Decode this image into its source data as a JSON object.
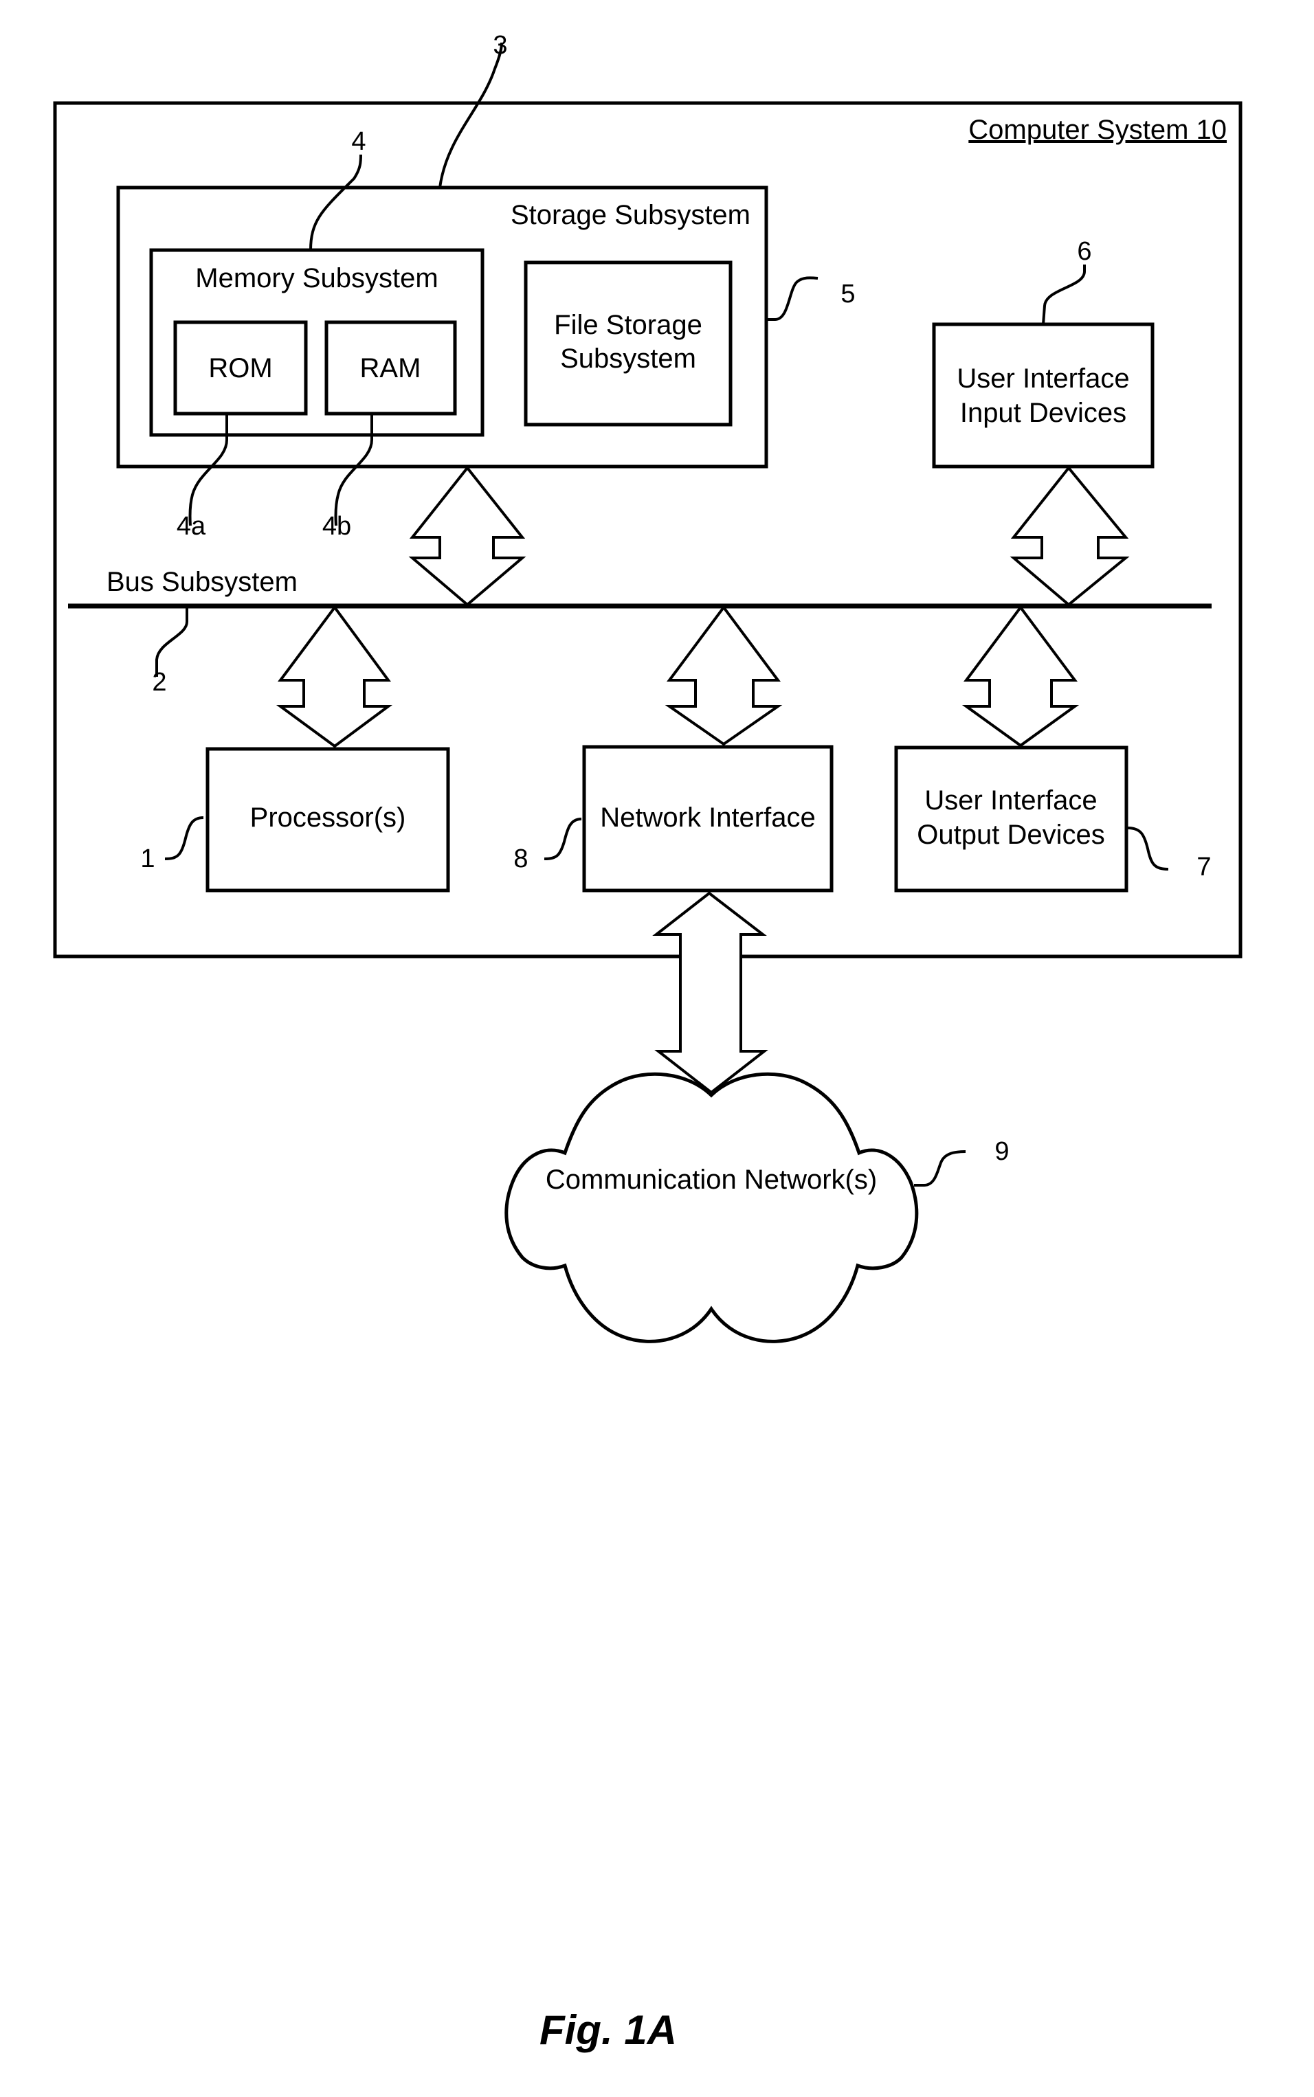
{
  "figure": {
    "caption": "Fig. 1A",
    "title": "Computer System 10"
  },
  "components": {
    "storage_subsystem": {
      "label": "Storage Subsystem",
      "ref": "3"
    },
    "memory_subsystem": {
      "label": "Memory Subsystem",
      "ref": "4"
    },
    "rom": {
      "label": "ROM",
      "ref": "4a"
    },
    "ram": {
      "label": "RAM",
      "ref": "4b"
    },
    "file_storage": {
      "line1": "File Storage",
      "line2": "Subsystem",
      "ref": "5"
    },
    "ui_input": {
      "line1": "User Interface",
      "line2": "Input Devices",
      "ref": "6"
    },
    "bus": {
      "label": "Bus Subsystem",
      "ref": "2"
    },
    "processor": {
      "label": "Processor(s)",
      "ref": "1"
    },
    "network_interface": {
      "label": "Network Interface",
      "ref": "8"
    },
    "ui_output": {
      "line1": "User Interface",
      "line2": "Output Devices",
      "ref": "7"
    },
    "network": {
      "label": "Communication Network(s)",
      "ref": "9"
    }
  }
}
